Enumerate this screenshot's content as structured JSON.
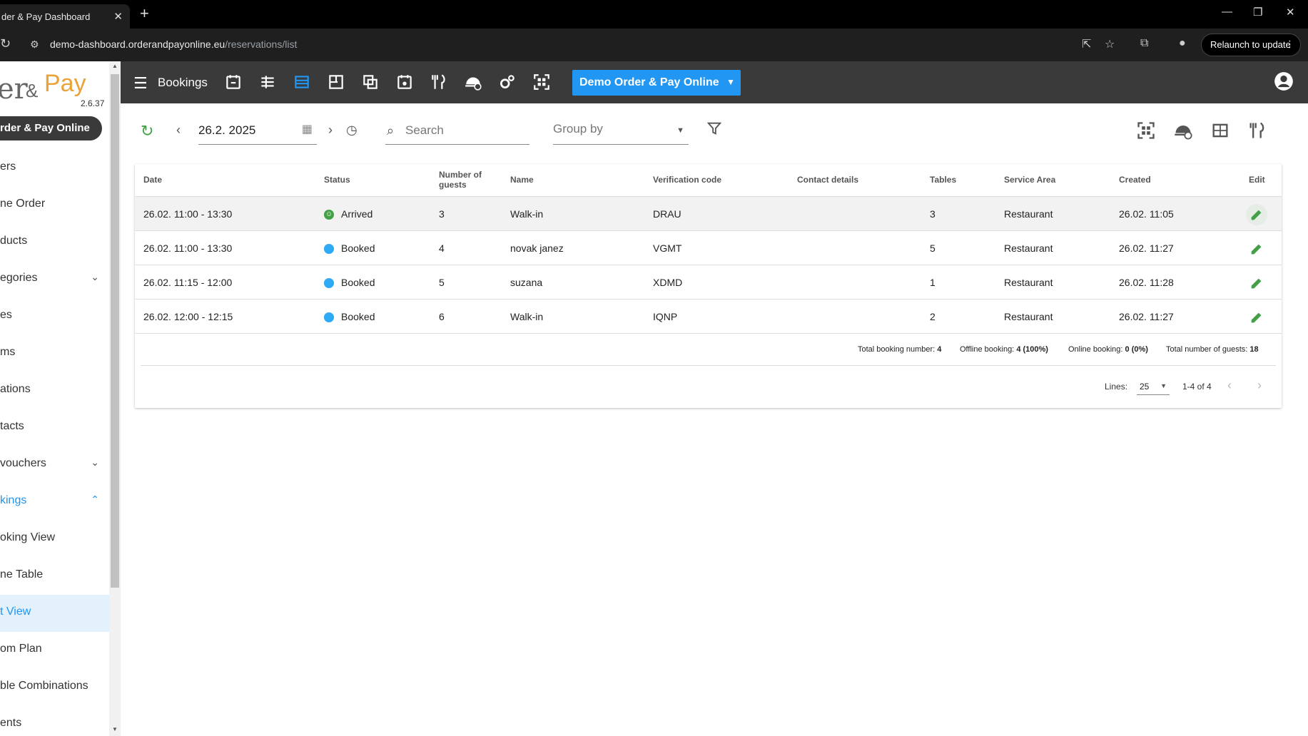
{
  "browser": {
    "tab_title": "der & Pay Dashboard",
    "tab_close": "✕",
    "new_tab": "+",
    "url_host": "demo-dashboard.orderandpayonline.eu",
    "url_path": "/reservations/list",
    "relaunch_label": "Relaunch to update"
  },
  "sidebar": {
    "logo_left": "er",
    "logo_amp": "&",
    "logo_right": "Pay",
    "version": "2.6.37",
    "org_label": "rder & Pay Online",
    "items": [
      {
        "label": "ers"
      },
      {
        "label": "ne Order"
      },
      {
        "label": "ducts"
      },
      {
        "label": "egories"
      },
      {
        "label": "es"
      },
      {
        "label": "ms"
      },
      {
        "label": "ations"
      },
      {
        "label": "tacts"
      },
      {
        "label": "vouchers"
      },
      {
        "label": "kings"
      },
      {
        "label": "oking View"
      },
      {
        "label": "ne Table"
      },
      {
        "label": "t View"
      },
      {
        "label": "om Plan"
      },
      {
        "label": "ble Combinations"
      },
      {
        "label": "ents"
      }
    ]
  },
  "toolbar": {
    "title": "Bookings",
    "org_button": "Demo Order & Pay Online"
  },
  "filters": {
    "date_value": "26.2. 2025",
    "search_placeholder": "Search",
    "group_by_label": "Group by"
  },
  "table": {
    "headers": {
      "date": "Date",
      "status": "Status",
      "guests_1": "Number of",
      "guests_2": "guests",
      "name": "Name",
      "verification": "Verification code",
      "contact": "Contact details",
      "tables": "Tables",
      "service_area": "Service Area",
      "created": "Created",
      "edit": "Edit"
    },
    "rows": [
      {
        "date": "26.02. 11:00 - 13:30",
        "status": "Arrived",
        "guests": "3",
        "name": "Walk-in",
        "code": "DRAU",
        "contact": "",
        "tables": "3",
        "area": "Restaurant",
        "created": "26.02. 11:05"
      },
      {
        "date": "26.02. 11:00 - 13:30",
        "status": "Booked",
        "guests": "4",
        "name": "novak janez",
        "code": "VGMT",
        "contact": "",
        "tables": "5",
        "area": "Restaurant",
        "created": "26.02. 11:27"
      },
      {
        "date": "26.02. 11:15 - 12:00",
        "status": "Booked",
        "guests": "5",
        "name": "suzana",
        "code": "XDMD",
        "contact": "",
        "tables": "1",
        "area": "Restaurant",
        "created": "26.02. 11:28"
      },
      {
        "date": "26.02. 12:00 - 12:15",
        "status": "Booked",
        "guests": "6",
        "name": "Walk-in",
        "code": "IQNP",
        "contact": "",
        "tables": "2",
        "area": "Restaurant",
        "created": "26.02. 11:27"
      }
    ],
    "status_colors": {
      "Arrived": "#43a047",
      "Booked": "#2ea9f4"
    }
  },
  "totals": {
    "total_label": "Total booking number:",
    "total_value": "4",
    "offline_label": "Offline booking:",
    "offline_value": "4 (100%)",
    "online_label": "Online booking:",
    "online_value": "0 (0%)",
    "guests_label": "Total number of guests:",
    "guests_value": "18"
  },
  "pagination": {
    "lines_label": "Lines:",
    "lines_value": "25",
    "range": "1-4 of 4"
  },
  "colors": {
    "accent": "#2196f3",
    "toolbar": "#3a3a3a",
    "edit": "#43a047"
  }
}
